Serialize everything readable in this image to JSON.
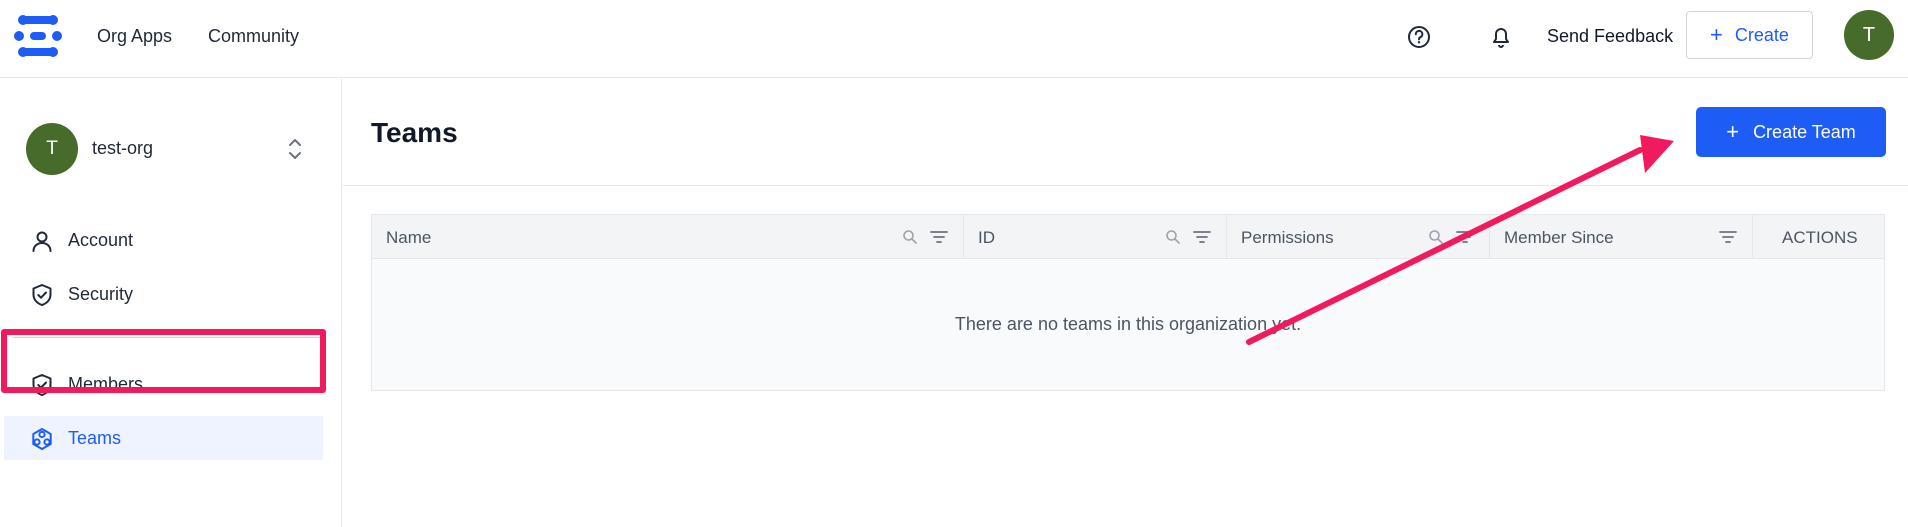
{
  "nav": {
    "org_apps": "Org Apps",
    "community": "Community",
    "send_feedback": "Send Feedback",
    "create_label": "Create",
    "user_initial": "T"
  },
  "org": {
    "initial": "T",
    "name": "test-org"
  },
  "sidebar": {
    "items": [
      {
        "label": "Account",
        "icon": "user-icon"
      },
      {
        "label": "Security",
        "icon": "shield-check-icon"
      },
      {
        "label": "Members",
        "icon": "shield-check-icon"
      },
      {
        "label": "Teams",
        "icon": "teams-icon",
        "active": true
      }
    ]
  },
  "main": {
    "title": "Teams",
    "create_team_label": "Create Team",
    "columns": [
      "Name",
      "ID",
      "Permissions",
      "Member Since",
      "ACTIONS"
    ],
    "empty_message": "There are no teams in this organization yet."
  },
  "colors": {
    "accent": "#1d5cf5",
    "avatar": "#476b2b",
    "annotation": "#f2195c"
  }
}
